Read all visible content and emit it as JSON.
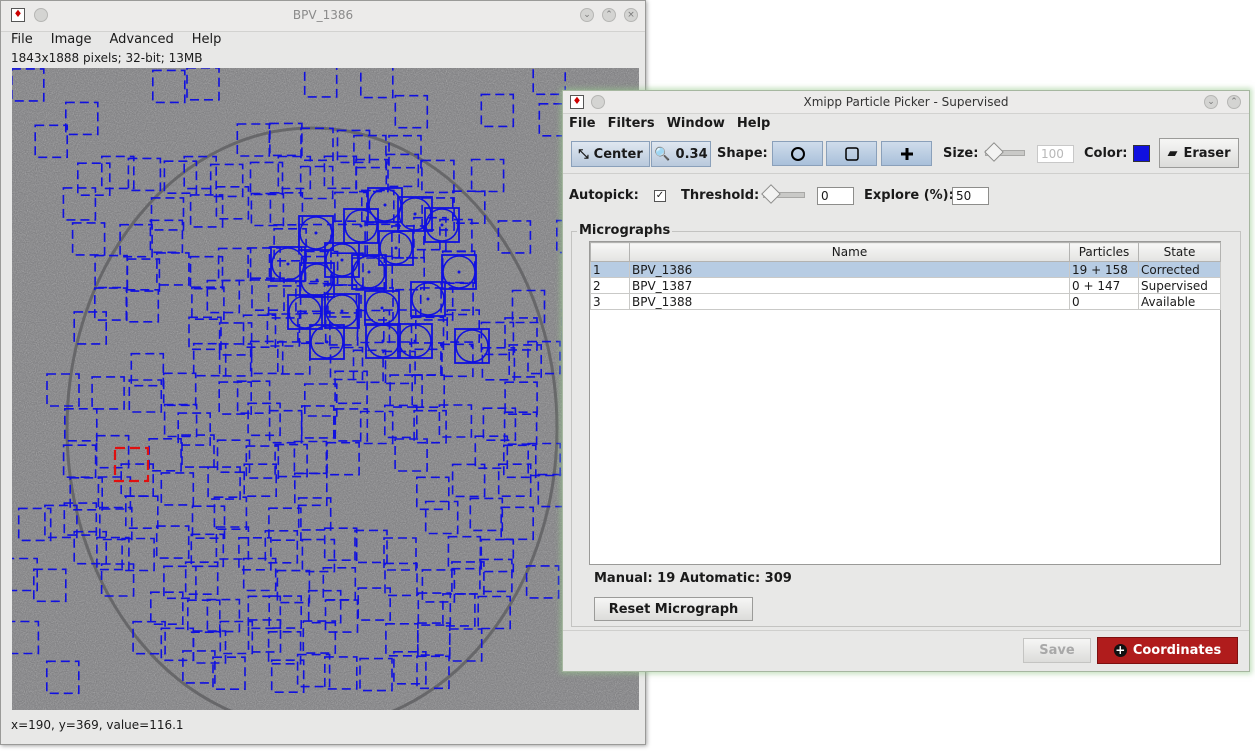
{
  "image_window": {
    "title": "BPV_1386",
    "app_icon": "imagej-icon",
    "menu": [
      "File",
      "Image",
      "Advanced",
      "Help"
    ],
    "info": "1843x1888 pixels; 32-bit; 13MB",
    "status": "x=190, y=369, value=116.1",
    "box_color": "#1010e0",
    "selected_box_color": "#e01010"
  },
  "picker": {
    "title": "Xmipp Particle Picker - Supervised",
    "app_icon": "imagej-icon",
    "menu": [
      "File",
      "Filters",
      "Window",
      "Help"
    ],
    "toolbar": {
      "center_label": "Center",
      "zoom_value": "0.34",
      "shape_label": "Shape:",
      "shape_icons": [
        "circle-icon",
        "square-icon",
        "plus-icon"
      ],
      "size_label": "Size:",
      "size_value": "100",
      "color_label": "Color:",
      "color_value": "#1010e0",
      "eraser_label": "Eraser"
    },
    "autopick": {
      "label": "Autopick:",
      "checked": true,
      "threshold_label": "Threshold:",
      "threshold_value": "0",
      "explore_label": "Explore (%):",
      "explore_value": "50"
    },
    "micrographs": {
      "title": "Micrographs",
      "columns": [
        "",
        "Name",
        "Particles",
        "State"
      ],
      "rows": [
        {
          "index": "1",
          "name": "BPV_1386",
          "particles": "19 + 158",
          "state": "Corrected",
          "selected": true
        },
        {
          "index": "2",
          "name": "BPV_1387",
          "particles": "0 + 147",
          "state": "Supervised",
          "selected": false
        },
        {
          "index": "3",
          "name": "BPV_1388",
          "particles": "0",
          "state": "Available",
          "selected": false
        }
      ],
      "summary": "Manual: 19 Automatic: 309",
      "reset_label": "Reset Micrograph"
    },
    "save_label": "Save",
    "coordinates_label": "Coordinates",
    "coordinates_color": "#b01c1c"
  }
}
